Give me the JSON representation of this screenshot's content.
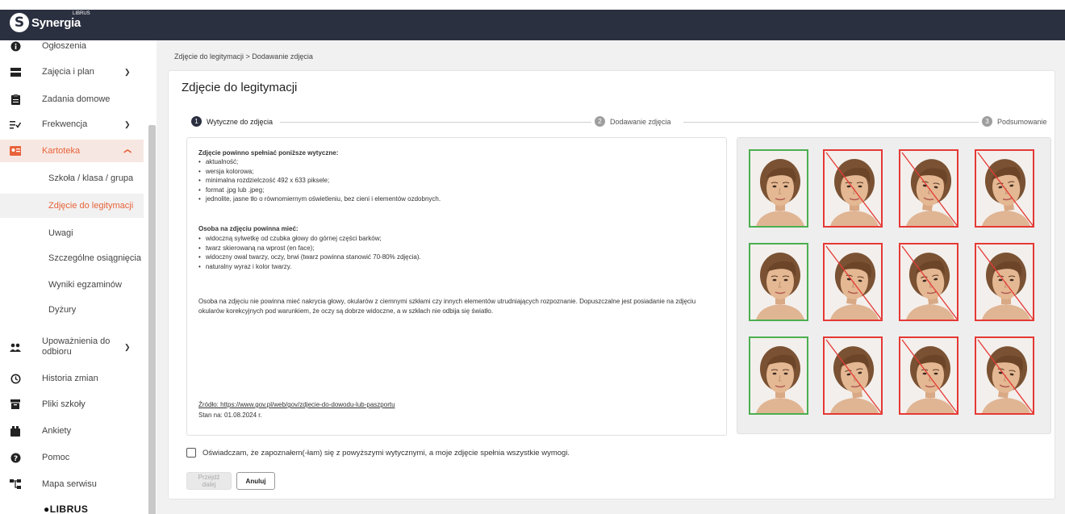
{
  "app": {
    "logo_text": "Synergia",
    "logo_sup": "LIBRUS",
    "footer_logo": "LIBRUS"
  },
  "sidebar": {
    "items": [
      {
        "label": "Ogłoszenia",
        "icon": "info-icon"
      },
      {
        "label": "Zajęcia i plan",
        "icon": "schedule-icon",
        "expandable": true
      },
      {
        "label": "Zadania domowe",
        "icon": "clipboard-icon"
      },
      {
        "label": "Frekwencja",
        "icon": "attendance-icon",
        "expandable": true
      },
      {
        "label": "Kartoteka",
        "icon": "id-card-icon",
        "expandable": true,
        "expanded": true
      },
      {
        "label": "Upoważnienia do",
        "label2": "odbioru",
        "icon": "people-icon",
        "expandable": true
      },
      {
        "label": "Historia zmian",
        "icon": "history-icon"
      },
      {
        "label": "Pliki szkoły",
        "icon": "archive-icon"
      },
      {
        "label": "Ankiety",
        "icon": "poll-icon"
      },
      {
        "label": "Pomoc",
        "icon": "help-icon"
      },
      {
        "label": "Mapa serwisu",
        "icon": "sitemap-icon"
      }
    ],
    "subitems": [
      {
        "label": "Szkoła / klasa / grupa"
      },
      {
        "label": "Zdjęcie do legitymacji",
        "active": true
      },
      {
        "label": "Uwagi"
      },
      {
        "label": "Szczególne osiągnięcia"
      },
      {
        "label": "Wyniki egzaminów"
      },
      {
        "label": "Dyżury"
      }
    ]
  },
  "breadcrumb": "Zdjęcie do legitymacji  >  Dodawanie zdjęcia",
  "page_title": "Zdjęcie do legitymacji",
  "steps": [
    {
      "num": "1",
      "label": "Wytyczne do zdjęcia",
      "active": true
    },
    {
      "num": "2",
      "label": "Dodawanie zdjęcia"
    },
    {
      "num": "3",
      "label": "Podsumowanie"
    }
  ],
  "guidelines": {
    "heading1": "Zdjęcie powinno spełniać poniższe wytyczne:",
    "list1": [
      "aktualność;",
      "wersja kolorowa;",
      "minimalna rozdzielczość 492 x 633 piksele;",
      "format .jpg lub .jpeg;",
      "jednolite, jasne tło o równomiernym oświetleniu, bez cieni i elementów ozdobnych."
    ],
    "heading2": "Osoba na zdjęciu powinna mieć:",
    "list2": [
      "widoczną sylwetkę od czubka głowy do górnej części barków;",
      "twarz skierowaną na wprost (en face);",
      "widoczny owal twarzy, oczy, brwi (twarz powinna stanowić 70-80% zdjęcia).",
      "naturalny wyraz i kolor twarzy."
    ],
    "paragraph": "Osoba na zdjęciu nie powinna mieć nakrycia głowy, okularów z ciemnymi szkłami czy innych elementów utrudniających rozpoznanie. Dopuszczalne jest posiadanie na zdjęciu okularów korekcyjnych pod warunkiem, że oczy są dobrze widoczne, a w szkłach nie odbija się światło.",
    "source": "Źródło: https://www.gov.pl/web/gov/zdjecie-do-dowodu-lub-paszportu",
    "date": "Stan na: 01.08.2024 r."
  },
  "photos": [
    {
      "status": "ok"
    },
    {
      "status": "bad"
    },
    {
      "status": "bad"
    },
    {
      "status": "bad"
    },
    {
      "status": "ok"
    },
    {
      "status": "bad"
    },
    {
      "status": "bad"
    },
    {
      "status": "bad"
    },
    {
      "status": "ok"
    },
    {
      "status": "bad"
    },
    {
      "status": "bad"
    },
    {
      "status": "bad"
    }
  ],
  "consent_label": "Oświadczam, że zapoznałem(-łam) się z powyższymi wytycznymi, a moje zdjęcie spełnia wszystkie wymogi.",
  "buttons": {
    "next": "Przejdź dalej",
    "cancel": "Anuluj"
  },
  "colors": {
    "accent": "#e8633a",
    "topbar": "#2b3040",
    "ok": "#4caf50",
    "bad": "#e53935"
  }
}
